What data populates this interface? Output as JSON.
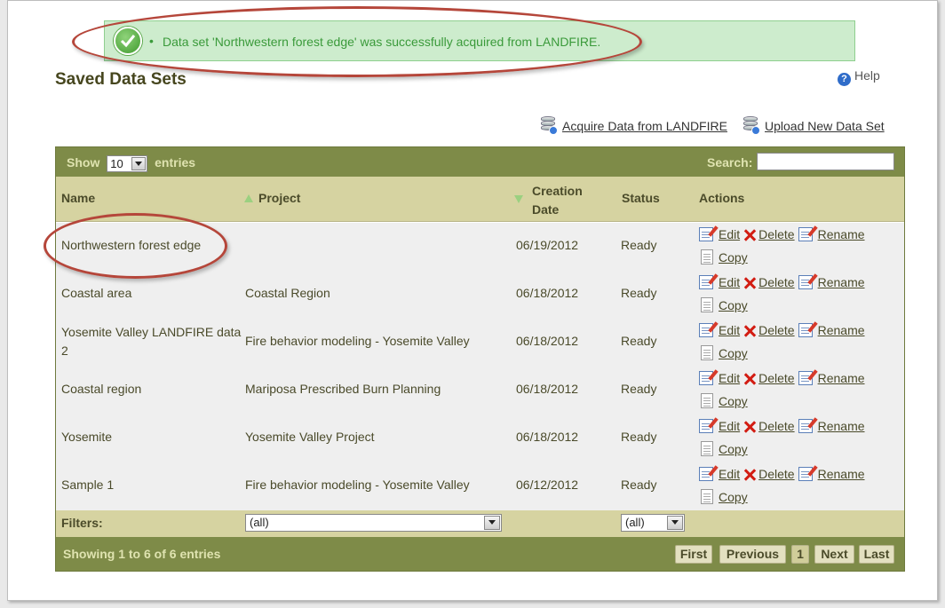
{
  "banner": {
    "message": "Data set 'Northwestern forest edge' was successfully acquired from LANDFIRE."
  },
  "page_title": "Saved Data Sets",
  "help_label": "Help",
  "links": {
    "acquire": "Acquire Data from LANDFIRE",
    "upload": "Upload New Data Set"
  },
  "table_controls": {
    "show_label": "Show",
    "entries_label": "entries",
    "page_size": "10",
    "search_label": "Search:",
    "search_value": ""
  },
  "columns": {
    "name": "Name",
    "project": "Project",
    "creation_date_line1": "Creation",
    "creation_date_line2": "Date",
    "status": "Status",
    "actions": "Actions"
  },
  "actions": {
    "edit": "Edit",
    "delete": "Delete",
    "rename": "Rename",
    "copy": "Copy"
  },
  "rows": [
    {
      "name": "Northwestern forest edge",
      "project": "",
      "date": "06/19/2012",
      "status": "Ready"
    },
    {
      "name": "Coastal area",
      "project": "Coastal Region",
      "date": "06/18/2012",
      "status": "Ready"
    },
    {
      "name": "Yosemite Valley LANDFIRE data 2",
      "project": "Fire behavior modeling - Yosemite Valley",
      "date": "06/18/2012",
      "status": "Ready"
    },
    {
      "name": "Coastal region",
      "project": "Mariposa Prescribed Burn Planning",
      "date": "06/18/2012",
      "status": "Ready"
    },
    {
      "name": "Yosemite",
      "project": "Yosemite Valley Project",
      "date": "06/18/2012",
      "status": "Ready"
    },
    {
      "name": "Sample 1",
      "project": "Fire behavior modeling - Yosemite Valley",
      "date": "06/12/2012",
      "status": "Ready"
    }
  ],
  "filters": {
    "label": "Filters:",
    "project_value": "(all)",
    "status_value": "(all)"
  },
  "footer": {
    "info": "Showing 1 to 6 of 6 entries",
    "first": "First",
    "previous": "Previous",
    "current_page": "1",
    "next": "Next",
    "last": "Last"
  }
}
